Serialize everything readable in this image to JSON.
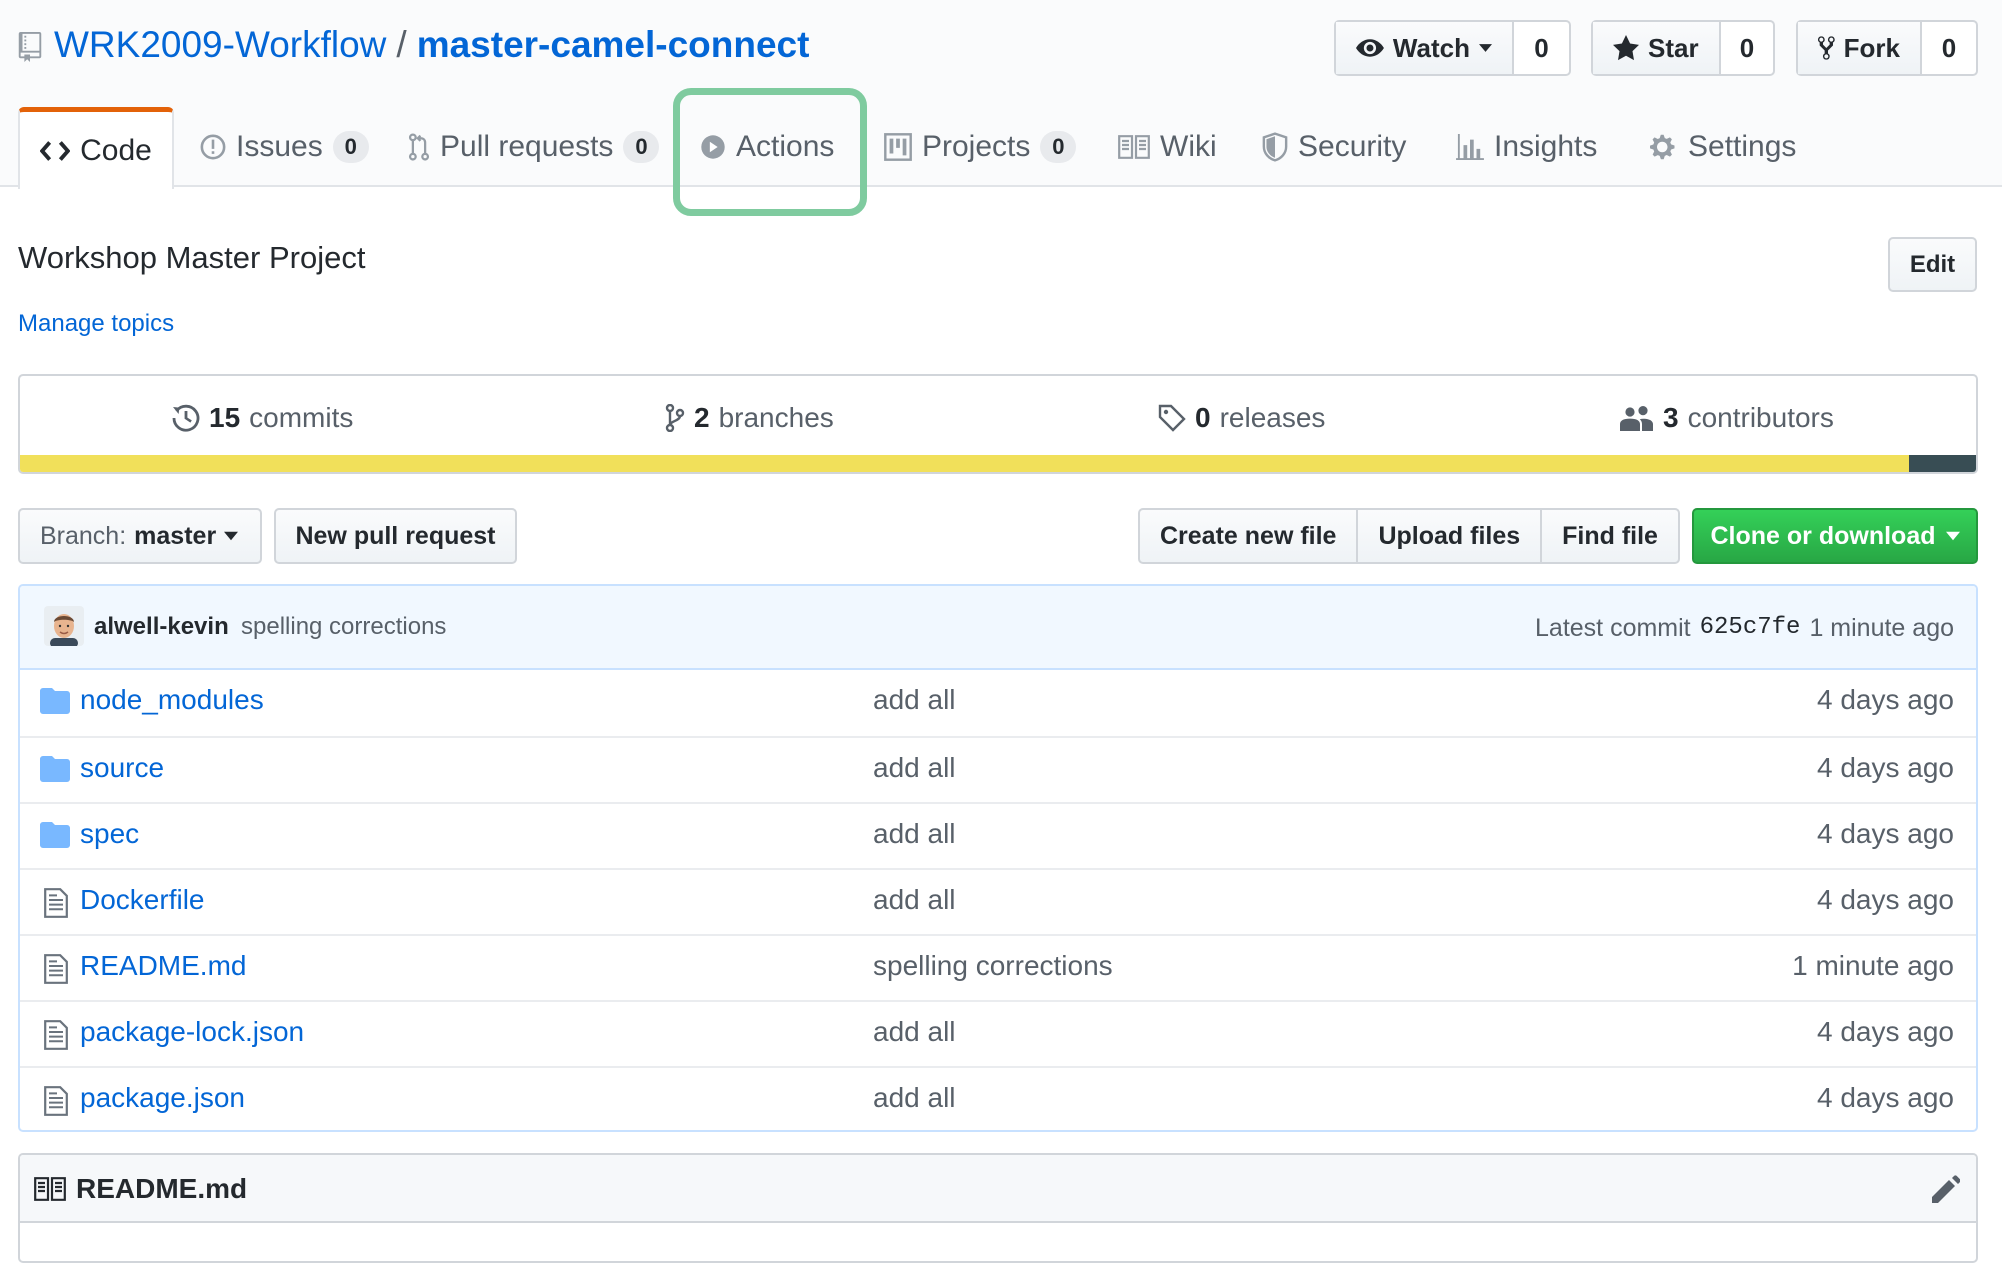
{
  "repo": {
    "owner": "WRK2009-Workflow",
    "separator": "/",
    "name": "master-camel-connect"
  },
  "social": {
    "watch": {
      "label": "Watch",
      "count": "0"
    },
    "star": {
      "label": "Star",
      "count": "0"
    },
    "fork": {
      "label": "Fork",
      "count": "0"
    }
  },
  "tabs": [
    {
      "label": "Code"
    },
    {
      "label": "Issues",
      "count": "0"
    },
    {
      "label": "Pull requests",
      "count": "0"
    },
    {
      "label": "Actions"
    },
    {
      "label": "Projects",
      "count": "0"
    },
    {
      "label": "Wiki"
    },
    {
      "label": "Security"
    },
    {
      "label": "Insights"
    },
    {
      "label": "Settings"
    }
  ],
  "description": "Workshop Master Project",
  "manage_topics": "Manage topics",
  "edit_label": "Edit",
  "summary": {
    "commits": {
      "count": "15",
      "label": "commits"
    },
    "branches": {
      "count": "2",
      "label": "branches"
    },
    "releases": {
      "count": "0",
      "label": "releases"
    },
    "contributors": {
      "count": "3",
      "label": "contributors"
    }
  },
  "language_bar": [
    {
      "share": 96.6,
      "color": "#f1e05a"
    },
    {
      "share": 3.4,
      "color": "#384d54"
    }
  ],
  "toolbar": {
    "branch_prefix": "Branch:",
    "branch_name": "master",
    "new_pull_request": "New pull request",
    "create_new_file": "Create new file",
    "upload_files": "Upload files",
    "find_file": "Find file",
    "clone_or_download": "Clone or download"
  },
  "latest_commit": {
    "author": "alwell-kevin",
    "message": "spelling corrections",
    "label": "Latest commit",
    "sha": "625c7fe",
    "age": "1 minute ago"
  },
  "files": [
    {
      "name": "node_modules",
      "type": "dir",
      "message": "add all",
      "age": "4 days ago"
    },
    {
      "name": "source",
      "type": "dir",
      "message": "add all",
      "age": "4 days ago"
    },
    {
      "name": "spec",
      "type": "dir",
      "message": "add all",
      "age": "4 days ago"
    },
    {
      "name": "Dockerfile",
      "type": "file",
      "message": "add all",
      "age": "4 days ago"
    },
    {
      "name": "README.md",
      "type": "file",
      "message": "spelling corrections",
      "age": "1 minute ago"
    },
    {
      "name": "package-lock.json",
      "type": "file",
      "message": "add all",
      "age": "4 days ago"
    },
    {
      "name": "package.json",
      "type": "file",
      "message": "add all",
      "age": "4 days ago"
    }
  ],
  "readme": {
    "title": "README.md"
  },
  "colors": {
    "link": "#0366d6",
    "highlight": "#7fcb9f",
    "active_tab": "#e36209",
    "primary_button": "#28a745"
  }
}
